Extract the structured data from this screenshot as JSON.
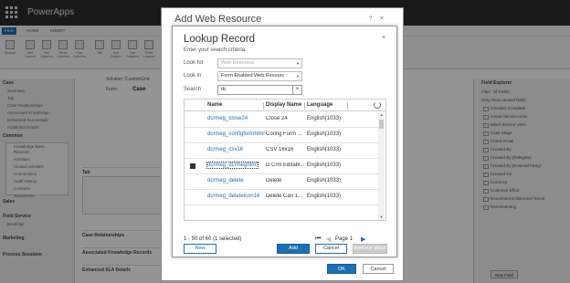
{
  "app": {
    "title": "PowerApps",
    "ribbon_tabs": [
      "FILE",
      "HOME",
      "INSERT"
    ],
    "ribbon_buttons": [
      "Section",
      "One Column",
      "Two Columns",
      "Three Columns",
      "Four Columns",
      "Tab",
      "One Column",
      "Two Columns",
      "Three Columns"
    ]
  },
  "left_nav": {
    "case_header": "Case",
    "case_items": [
      "Summary",
      "Tab",
      "Case Relationships",
      "Associated Knowledge...",
      "Enhanced SLA Details",
      "Additional Details"
    ],
    "common_header": "Common",
    "common_items": [
      "Knowledge Base Records",
      "Activities",
      "Closed Activities",
      "Connections",
      "Audit History",
      "Contacts",
      "Documents"
    ],
    "sales_header": "Sales",
    "field_service_header": "Field Service",
    "field_service_items": [
      "Bookings"
    ],
    "marketing_header": "Marketing",
    "process_header": "Process Sessions"
  },
  "form_header": {
    "solution_label": "Solution: CustomGrid",
    "form_label": "Form:",
    "form_name": "Case"
  },
  "form_sections": {
    "tab": "Tab",
    "case_relationships": "Case Relationships",
    "associated_knowledge": "Associated Knowledge Records",
    "enhanced_sla": "Enhanced SLA Details"
  },
  "field_explorer": {
    "title": "Field Explorer",
    "filter_label": "Filter",
    "filter_value": "All Fields",
    "only_unused": "Only show unused fields",
    "fields": [
      "Activities Complete",
      "Actual Service Units",
      "Billed Service Units",
      "Case Stage",
      "Check Email",
      "Created By",
      "Created By (Delegate)",
      "Created By (External Party)",
      "Created On",
      "Currency",
      "Customer Effort",
      "Decrement Entitlement Terms",
      "Decrementing"
    ],
    "new_field_button": "New Field"
  },
  "outer_dialog": {
    "title": "Add Web Resource",
    "help": "?",
    "close": "×",
    "ok_label": "OK",
    "cancel_label": "Cancel"
  },
  "lookup_dialog": {
    "title": "Lookup Record",
    "subtitle": "Enter your search criteria.",
    "close": "×",
    "look_for_label": "Look for",
    "look_for_value": "Web Resource",
    "look_in_label": "Look in",
    "look_in_value": "Form Enabled Web Resourc",
    "search_label": "Search",
    "search_value": "dc",
    "search_clear": "×",
    "columns": [
      "Name",
      "Display Name",
      "Language"
    ],
    "rows": [
      {
        "name": "dcrmeg_close24",
        "display": "Close 24",
        "language": "English(1033)",
        "checked": false
      },
      {
        "name": "dcrmeg_configformhtml",
        "display": "Config Form ...",
        "language": "English(1033)",
        "checked": false
      },
      {
        "name": "dcrmeg_csv16",
        "display": "CSV 16x16",
        "language": "English(1033)",
        "checked": false
      },
      {
        "name": "dcrmeg_dcrmeghtml",
        "display": "D Crm Editabl...",
        "language": "English(1033)",
        "checked": true
      },
      {
        "name": "dcrmeg_delete",
        "display": "Delete",
        "language": "English(1033)",
        "checked": false
      },
      {
        "name": "dcrmeg_deleteicon16",
        "display": "Delete Can 1...",
        "language": "English(1033)",
        "checked": false
      }
    ],
    "record_count": "1 - 50 of 60 (1 selected)",
    "page_label": "Page 1",
    "new_label": "New",
    "add_label": "Add",
    "cancel_label": "Cancel",
    "remove_label": "Remove Value"
  },
  "colors": {
    "accent": "#1f6fb2",
    "topbar": "#2b2b2b",
    "backdrop": "rgba(0,0,0,0.42)"
  }
}
